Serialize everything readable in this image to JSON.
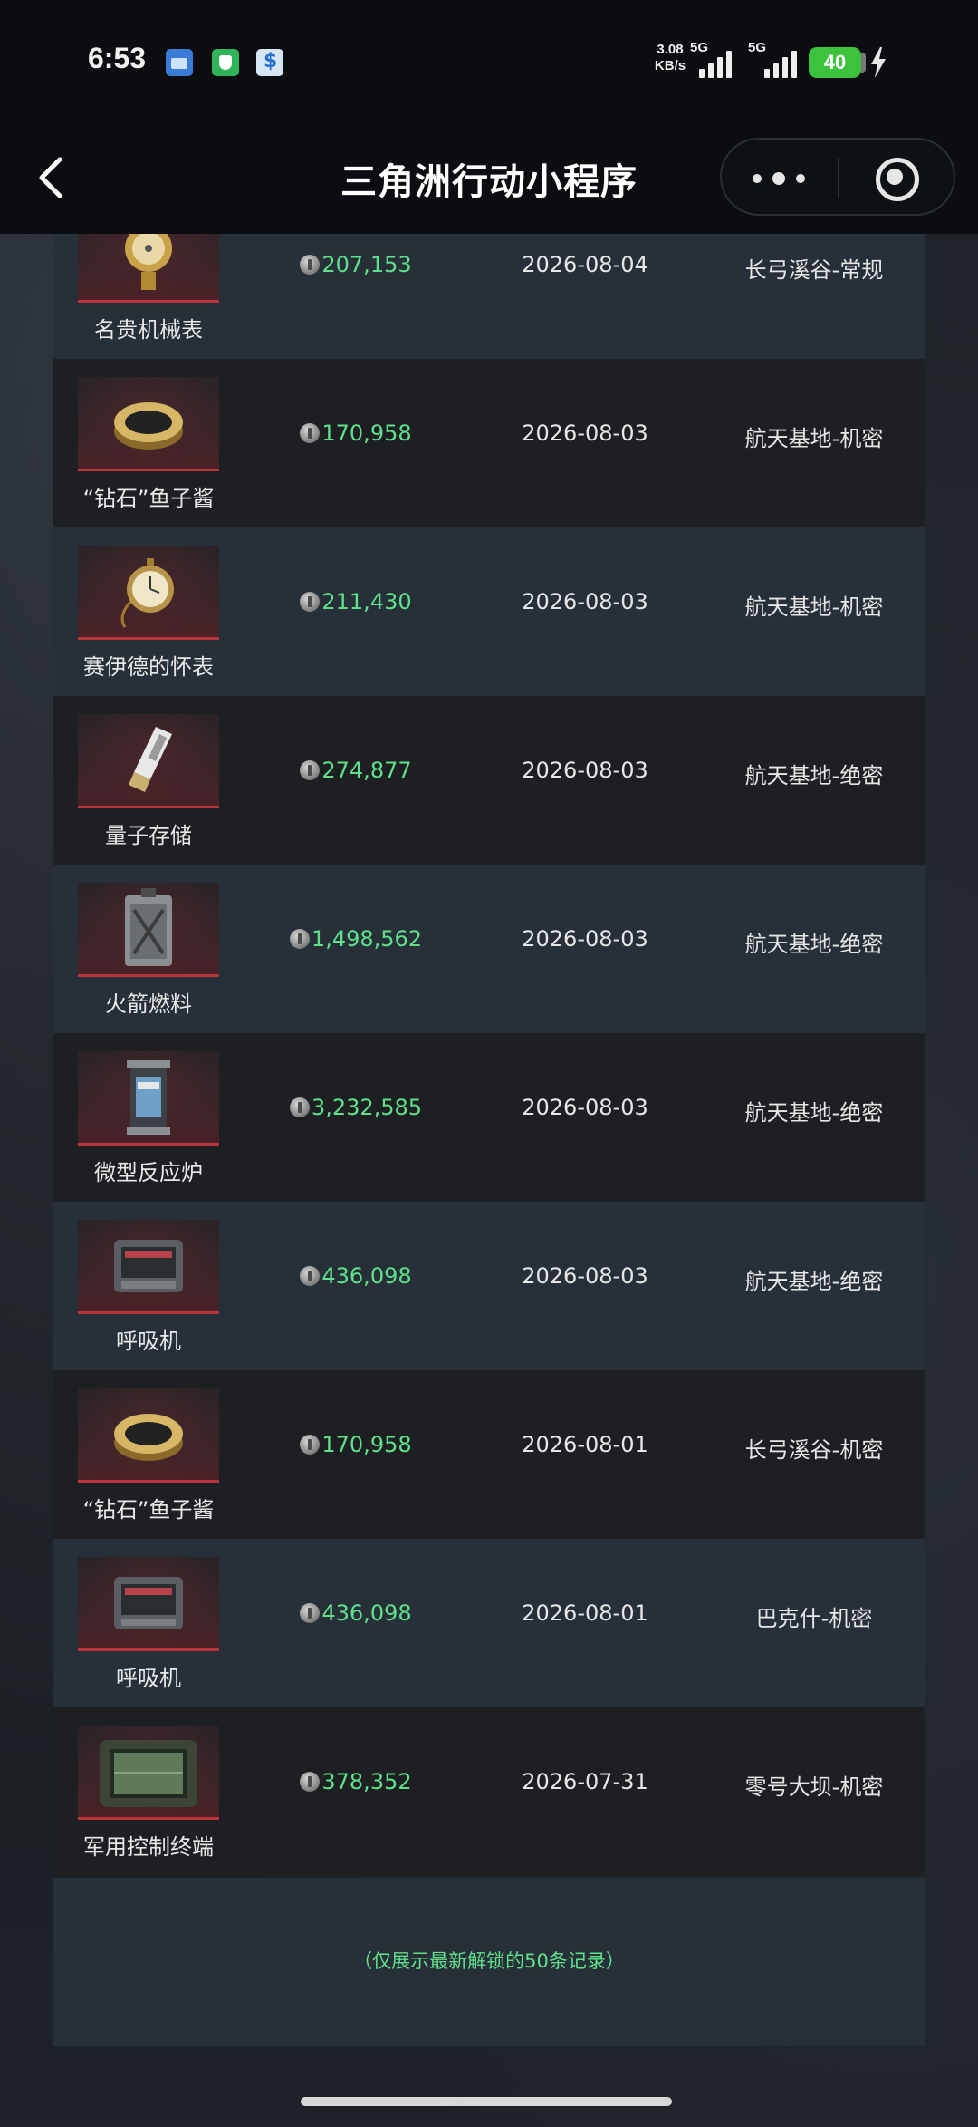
{
  "status_bar": {
    "time": "6:53",
    "net_speed_value": "3.08",
    "net_speed_unit": "KB/s",
    "signal1_label": "5G",
    "signal2_label": "5G",
    "battery": "40"
  },
  "header": {
    "title": "三角洲行动小程序"
  },
  "records": [
    {
      "name": "名贵机械表",
      "price": "207,153",
      "date": "2026-08-04",
      "map": "长弓溪谷-常规",
      "icon": "watch-icon"
    },
    {
      "name": "“钻石”鱼子酱",
      "price": "170,958",
      "date": "2026-08-03",
      "map": "航天基地-机密",
      "icon": "caviar-icon"
    },
    {
      "name": "赛伊德的怀表",
      "price": "211,430",
      "date": "2026-08-03",
      "map": "航天基地-机密",
      "icon": "pocket-watch-icon"
    },
    {
      "name": "量子存储",
      "price": "274,877",
      "date": "2026-08-03",
      "map": "航天基地-绝密",
      "icon": "usb-drive-icon"
    },
    {
      "name": "火箭燃料",
      "price": "1,498,562",
      "date": "2026-08-03",
      "map": "航天基地-绝密",
      "icon": "fuel-can-icon"
    },
    {
      "name": "微型反应炉",
      "price": "3,232,585",
      "date": "2026-08-03",
      "map": "航天基地-绝密",
      "icon": "reactor-icon"
    },
    {
      "name": "呼吸机",
      "price": "436,098",
      "date": "2026-08-03",
      "map": "航天基地-绝密",
      "icon": "ventilator-icon"
    },
    {
      "name": "“钻石”鱼子酱",
      "price": "170,958",
      "date": "2026-08-01",
      "map": "长弓溪谷-机密",
      "icon": "caviar-icon"
    },
    {
      "name": "呼吸机",
      "price": "436,098",
      "date": "2026-08-01",
      "map": "巴克什-机密",
      "icon": "ventilator-icon"
    },
    {
      "name": "军用控制终端",
      "price": "378,352",
      "date": "2026-07-31",
      "map": "零号大坝-机密",
      "icon": "control-terminal-icon"
    }
  ],
  "footer": {
    "note": "（仅展示最新解锁的50条记录）"
  },
  "colors": {
    "price_green": "#5fe08a",
    "row_light": "#273038",
    "row_dark": "#1d1f23",
    "thumb_accent_red": "#b8333c",
    "battery_green": "#3cc23c"
  }
}
